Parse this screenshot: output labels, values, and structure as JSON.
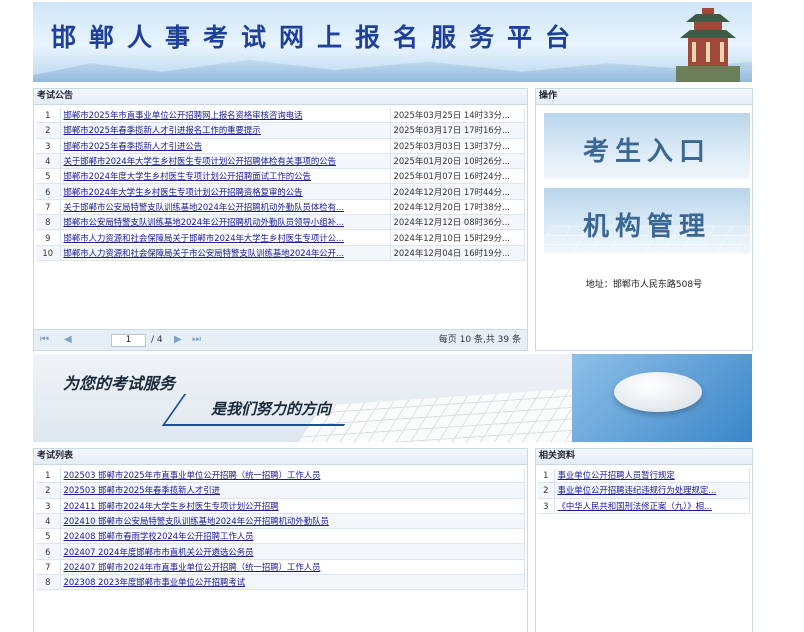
{
  "header": {
    "title": "邯郸人事考试网上报名服务平台"
  },
  "announcements": {
    "heading": "考试公告",
    "rows": [
      {
        "num": "1",
        "title": "邯郸市2025年市直事业单位公开招聘网上报名资格审核咨询电话",
        "date": "2025年03月25日 14时33分..."
      },
      {
        "num": "2",
        "title": "邯郸市2025年春季揽新人才引进报名工作的重要提示",
        "date": "2025年03月17日 17时16分..."
      },
      {
        "num": "3",
        "title": "邯郸市2025年春季揽新人才引进公告",
        "date": "2025年03月03日 13时37分..."
      },
      {
        "num": "4",
        "title": "关于邯郸市2024年大学生乡村医生专项计划公开招聘体检有关事项的公告",
        "date": "2025年01月20日 10时26分..."
      },
      {
        "num": "5",
        "title": "邯郸市2024年度大学生乡村医生专项计划公开招聘面试工作的公告",
        "date": "2025年01月07日 16时24分..."
      },
      {
        "num": "6",
        "title": "邯郸市2024年大学生乡村医生专项计划公开招聘资格复审的公告",
        "date": "2024年12月20日 17时44分..."
      },
      {
        "num": "7",
        "title": "关于邯郸市公安局特警支队训练基地2024年公开招聘机动外勤队员体检有...",
        "date": "2024年12月20日 17时38分..."
      },
      {
        "num": "8",
        "title": "邯郸市公安局特警支队训练基地2024年公开招聘机动外勤队员领导小组补...",
        "date": "2024年12月12日 08时36分..."
      },
      {
        "num": "9",
        "title": "邯郸市人力资源和社会保障局关于邯郸市2024年大学生乡村医生专项计公...",
        "date": "2024年12月10日 15时29分..."
      },
      {
        "num": "10",
        "title": "邯郸市人力资源和社会保障局关于市公安局特警支队训练基地2024年公开...",
        "date": "2024年12月04日 16时19分..."
      }
    ],
    "pager": {
      "current_page": "1",
      "total_pages": "/ 4",
      "info": "每页 10 条,共 39 条"
    }
  },
  "operations": {
    "heading": "操作",
    "candidate_entry": "考生入口",
    "org_management": "机构管理",
    "address": "地址：邯郸市人民东路508号"
  },
  "banner": {
    "line1": "为您的考试服务",
    "line2": "是我们努力的方向"
  },
  "exam_list": {
    "heading": "考试列表",
    "rows": [
      {
        "num": "1",
        "title": "202503 邯郸市2025年市直事业单位公开招聘（统一招聘）工作人员"
      },
      {
        "num": "2",
        "title": "202503 邯郸市2025年春季揽新人才引进"
      },
      {
        "num": "3",
        "title": "202411 邯郸市2024年大学生乡村医生专项计划公开招聘"
      },
      {
        "num": "4",
        "title": "202410 邯郸市公安局特警支队训练基地2024年公开招聘机动外勤队员"
      },
      {
        "num": "5",
        "title": "202408 邯郸市春雨学校2024年公开招聘工作人员"
      },
      {
        "num": "6",
        "title": "202407 2024年度邯郸市市直机关公开遴选公务员"
      },
      {
        "num": "7",
        "title": "202407 邯郸市2024年市直事业单位公开招聘（统一招聘）工作人员"
      },
      {
        "num": "8",
        "title": "202308 2023年度邯郸市事业单位公开招聘考试"
      }
    ]
  },
  "resources": {
    "heading": "相关资料",
    "rows": [
      {
        "num": "1",
        "title": "事业单位公开招聘人员暂行规定"
      },
      {
        "num": "2",
        "title": "事业单位公开招聘违纪违规行为处理规定..."
      },
      {
        "num": "3",
        "title": "《中华人民共和国刑法修正案（九）》相..."
      }
    ]
  }
}
